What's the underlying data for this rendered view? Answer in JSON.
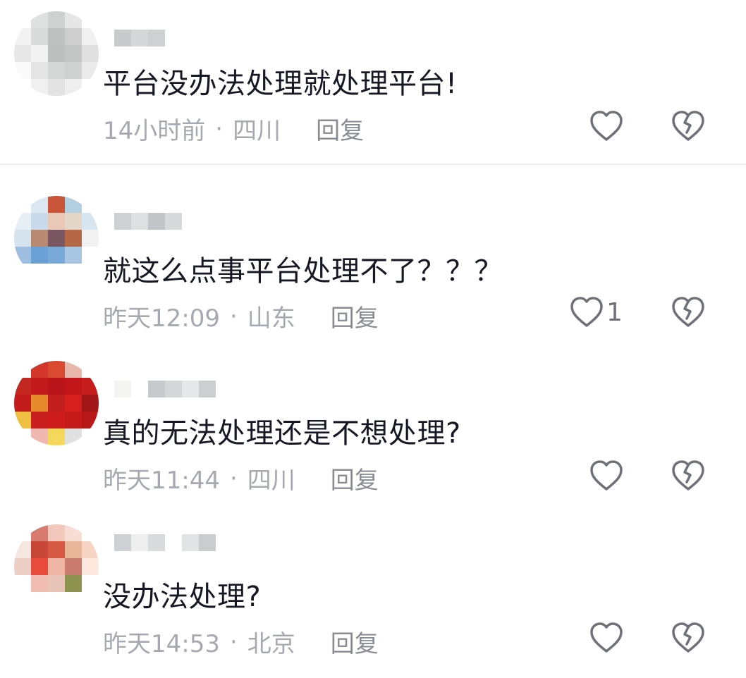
{
  "comments": [
    {
      "text": "平台没办法处理就处理平台!",
      "time": "14小时前",
      "location": "四川",
      "reply": "回复",
      "like_count": ""
    },
    {
      "text": "就这么点事平台处理不了？？？",
      "time": "昨天12:09",
      "location": "山东",
      "reply": "回复",
      "like_count": "1"
    },
    {
      "text": "真的无法处理还是不想处理?",
      "time": "昨天11:44",
      "location": "四川",
      "reply": "回复",
      "like_count": ""
    },
    {
      "text": "没办法处理?",
      "time": "昨天14:53",
      "location": "北京",
      "reply": "回复",
      "like_count": ""
    }
  ],
  "meta": {
    "separator": "·"
  },
  "icons": {
    "like": "heart-outline-icon",
    "dislike": "broken-heart-icon"
  },
  "colors": {
    "text": "#161823",
    "meta": "#a7a9b0",
    "icon": "#6f7178"
  }
}
